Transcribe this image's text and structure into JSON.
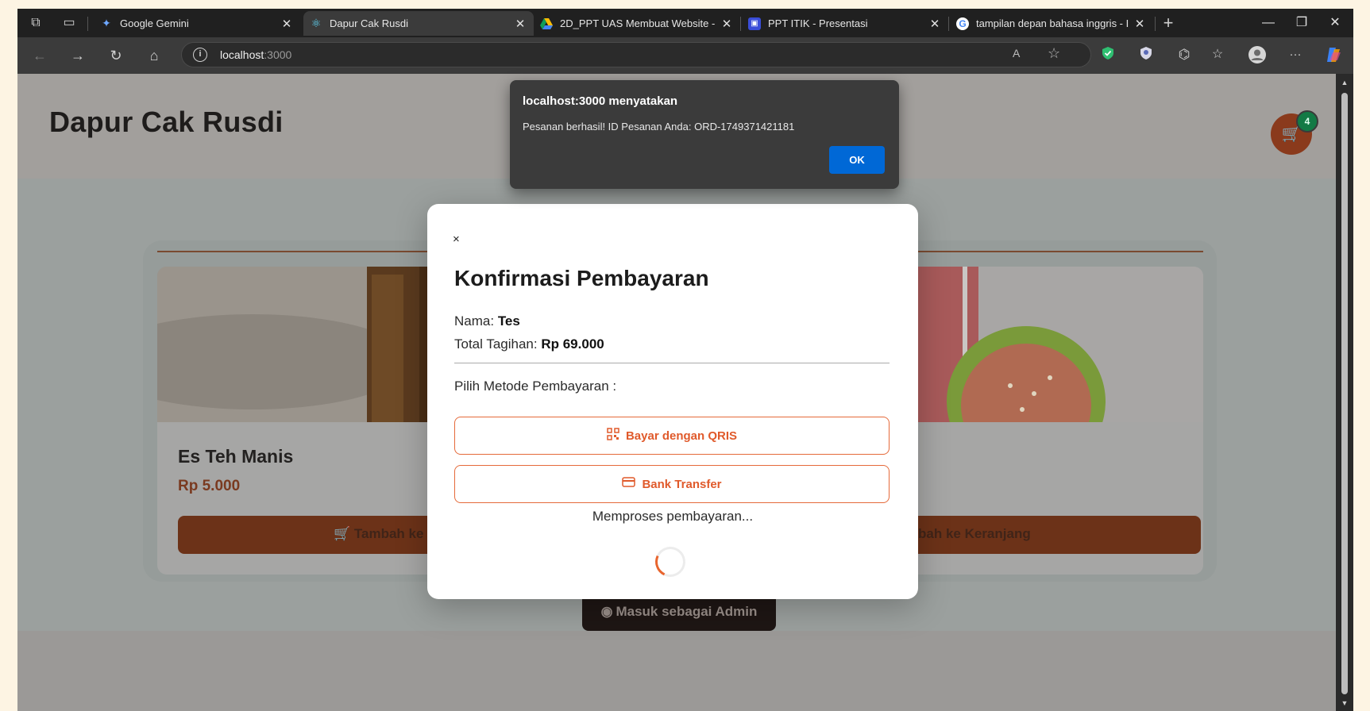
{
  "browser": {
    "tabs": [
      {
        "title": "Google Gemini",
        "active": false
      },
      {
        "title": "Dapur Cak Rusdi",
        "active": true
      },
      {
        "title": "2D_PPT UAS Membuat Website -",
        "active": false
      },
      {
        "title": "PPT ITIK - Presentasi",
        "active": false
      },
      {
        "title": "tampilan depan bahasa inggris - I",
        "active": false
      }
    ],
    "new_tab": "+",
    "tab_close": "✕",
    "window_controls": {
      "minimize": "—",
      "restore": "❐",
      "close": "✕"
    },
    "nav": {
      "back": "←",
      "forward": "→",
      "reload": "↻",
      "home": "⌂"
    },
    "address": {
      "host": "localhost",
      "port": ":3000"
    },
    "toolbar_icons": {
      "read_aloud": "A",
      "favorite": "☆",
      "more": "···"
    }
  },
  "site": {
    "brand": "Dapur Cak Rusdi",
    "cart_count": "4",
    "product": {
      "name": "Es Teh Manis",
      "price": "Rp 5.000",
      "add_left": "Tambah ke K",
      "add_right": "bah ke Keranjang"
    },
    "admin_button": "Masuk sebagai Admin"
  },
  "modal": {
    "close": "×",
    "title": "Konfirmasi Pembayaran",
    "name_label": "Nama:",
    "name_value": "Tes",
    "total_label": "Total Tagihan:",
    "total_value": "Rp 69.000",
    "method_label": "Pilih Metode Pembayaran :",
    "qris_label": "Bayar dengan QRIS",
    "bank_label": "Bank Transfer",
    "processing": "Memproses pembayaran..."
  },
  "alert": {
    "title": "localhost:3000 menyatakan",
    "message": "Pesanan berhasil! ID Pesanan Anda: ORD-1749371421181",
    "ok": "OK"
  },
  "colors": {
    "accent": "#e56a3a",
    "alert_button": "#0068d6",
    "cart_badge": "#137a45"
  }
}
